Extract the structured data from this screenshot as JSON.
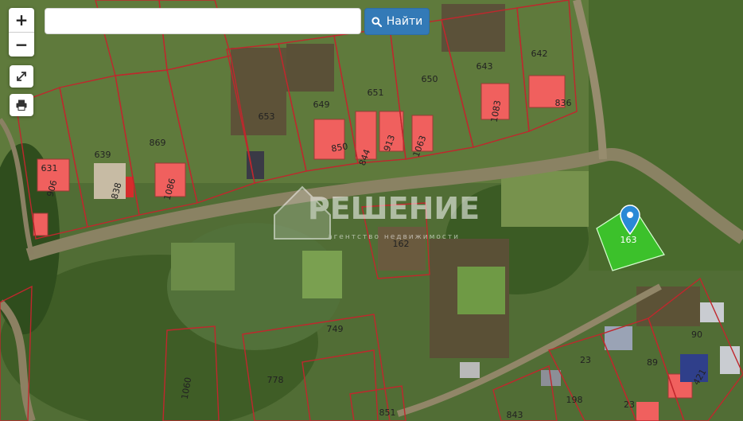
{
  "search": {
    "placeholder": "",
    "value": "",
    "button_label": "Найти"
  },
  "controls": {
    "zoom_in": "+",
    "zoom_out": "−"
  },
  "watermark": {
    "title": "РЕШЕНИЕ",
    "subtitle": "агентство недвижимости"
  },
  "selected_parcel": {
    "number": "163",
    "fill_color": "#39d02c"
  },
  "parcel_labels": [
    "631",
    "639",
    "869",
    "653",
    "649",
    "651",
    "650",
    "643",
    "642",
    "906",
    "838",
    "1086",
    "850",
    "844",
    "913",
    "1063",
    "1083",
    "836",
    "162",
    "749",
    "778",
    "1060",
    "851",
    "843",
    "198",
    "23",
    "89",
    "90",
    "421"
  ],
  "colors": {
    "accent": "#337ab7",
    "boundary": "#c0272d",
    "roof": "#f0605e",
    "marker": "#2a89d6"
  }
}
